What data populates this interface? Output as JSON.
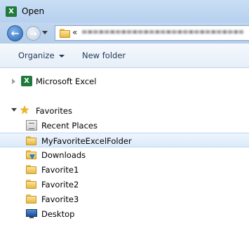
{
  "window": {
    "title": "Open",
    "app_icon_letter": "X"
  },
  "address_bar": {
    "separator": "«",
    "path_obscured": true
  },
  "toolbar": {
    "organize_label": "Organize",
    "new_folder_label": "New folder"
  },
  "tree": {
    "libraries": [
      {
        "label": "Microsoft Excel",
        "icon": "excel-icon"
      }
    ],
    "favorites_label": "Favorites",
    "favorites": [
      {
        "label": "Recent Places",
        "icon": "recent-places-icon"
      },
      {
        "label": "MyFavoriteExcelFolder",
        "icon": "folder-icon",
        "selected": true
      },
      {
        "label": "Downloads",
        "icon": "downloads-folder-icon"
      },
      {
        "label": "Favorite1",
        "icon": "folder-icon"
      },
      {
        "label": "Favorite2",
        "icon": "folder-icon"
      },
      {
        "label": "Favorite3",
        "icon": "folder-icon"
      },
      {
        "label": "Desktop",
        "icon": "desktop-icon"
      }
    ]
  },
  "colors": {
    "titlebar": "#c0d6f2",
    "selection": "#dbeaf9",
    "excel_green": "#1f7a3c",
    "folder_yellow": "#f0cd6a"
  }
}
